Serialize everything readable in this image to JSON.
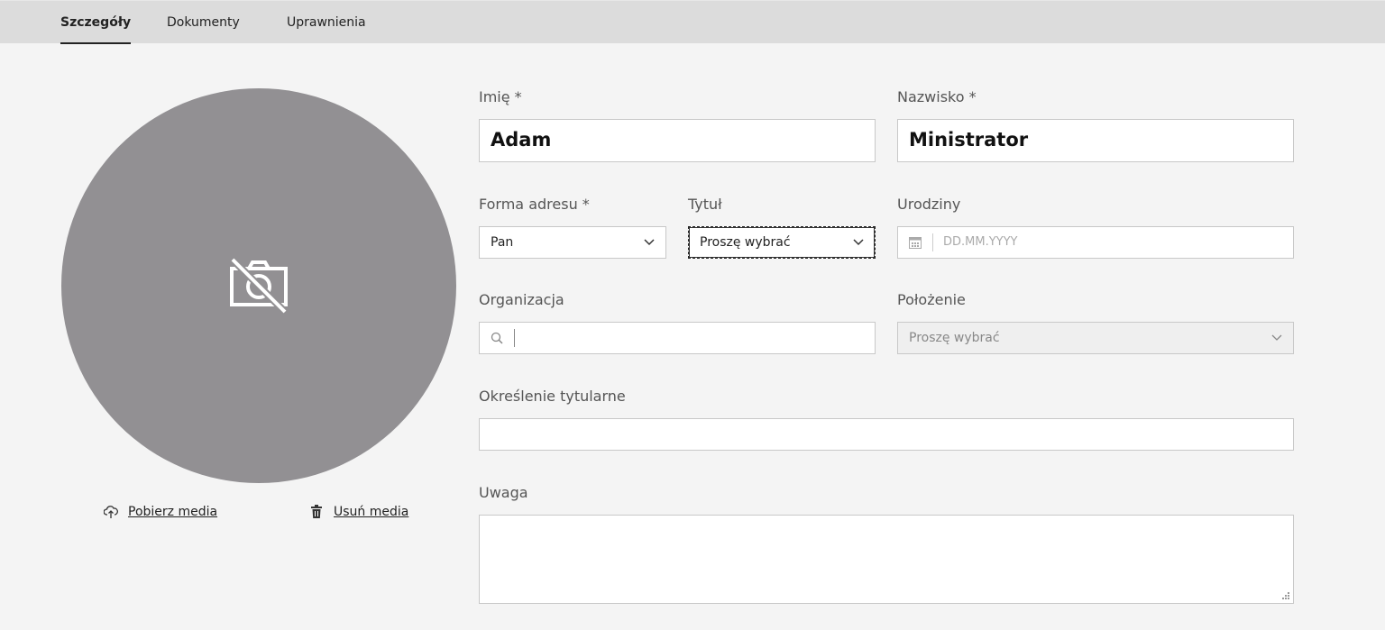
{
  "tabs": [
    {
      "label": "Szczegóły",
      "active": true
    },
    {
      "label": "Dokumenty",
      "active": false
    },
    {
      "label": "Uprawnienia",
      "active": false
    }
  ],
  "avatar": {
    "icon": "no-camera-icon"
  },
  "media": {
    "download_label": "Pobierz media",
    "delete_label": "Usuń media"
  },
  "form": {
    "first_name": {
      "label": "Imię *",
      "value": "Adam"
    },
    "last_name": {
      "label": "Nazwisko *",
      "value": "Ministrator"
    },
    "salutation": {
      "label": "Forma adresu *",
      "value": "Pan"
    },
    "title": {
      "label": "Tytuł",
      "value": "Proszę wybrać"
    },
    "birthday": {
      "label": "Urodziny",
      "placeholder": "DD.MM.YYYY"
    },
    "organization": {
      "label": "Organizacja",
      "value": ""
    },
    "position": {
      "label": "Położenie",
      "value": "Proszę wybrać"
    },
    "title_designation": {
      "label": "Określenie tytularne",
      "value": ""
    },
    "note": {
      "label": "Uwaga",
      "value": ""
    }
  }
}
